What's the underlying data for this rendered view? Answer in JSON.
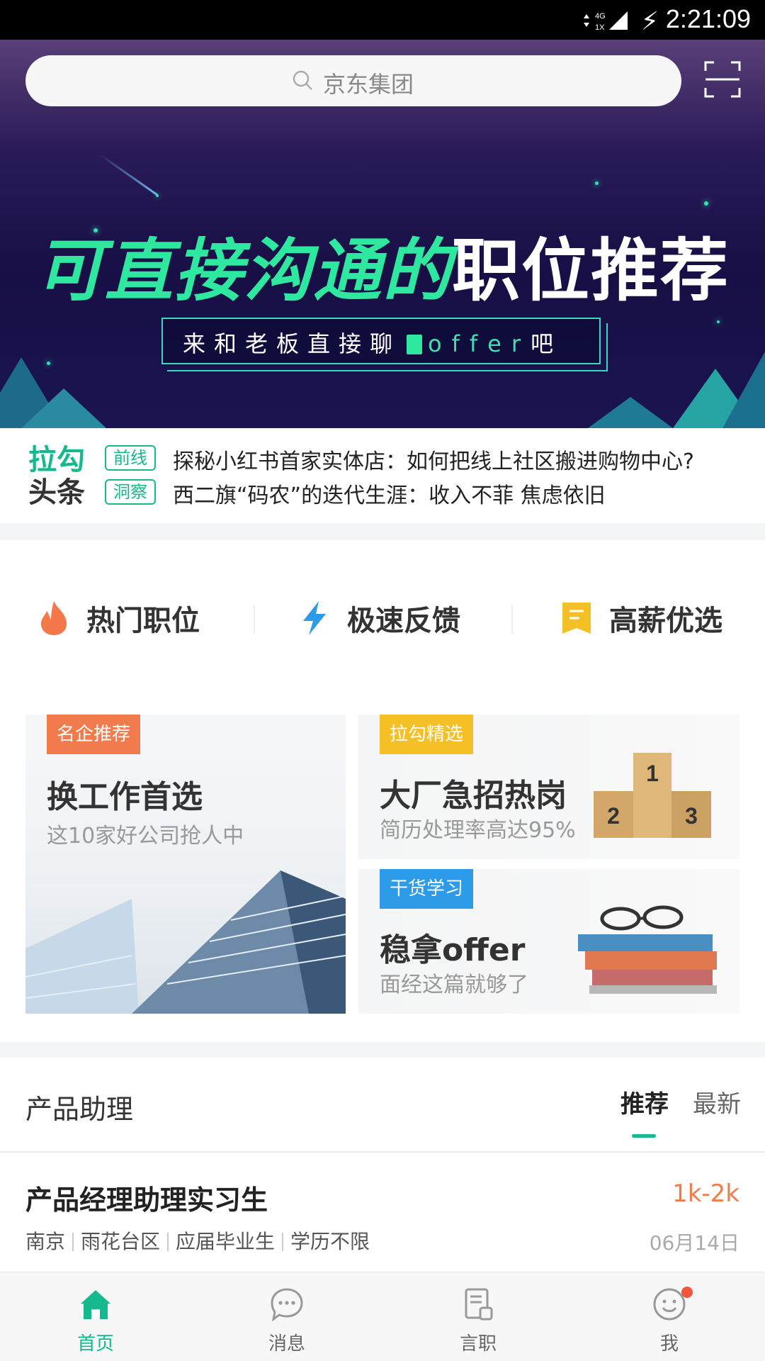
{
  "status_bar": {
    "time": "2:21:09",
    "network": "4G",
    "sim": "1X"
  },
  "banner": {
    "search_placeholder": "京东集团",
    "headline_green": "可直接沟通的",
    "headline_white": "职位推荐",
    "sub_pre": "来和老板直接聊",
    "sub_offer": "offer",
    "sub_post": "吧"
  },
  "news": {
    "logo_top": "拉勾",
    "logo_bottom": "头条",
    "items": [
      {
        "tag": "前线",
        "text": "探秘小红书首家实体店：如何把线上社区搬进购物中心?"
      },
      {
        "tag": "洞察",
        "text": "西二旗“码农”的迭代生涯：收入不菲 焦虑依旧"
      }
    ]
  },
  "quick_entries": [
    {
      "label": "热门职位",
      "icon": "flame-icon"
    },
    {
      "label": "极速反馈",
      "icon": "lightning-icon"
    },
    {
      "label": "高薪优选",
      "icon": "bookmark-icon"
    }
  ],
  "cards": {
    "left": {
      "badge": "名企推荐",
      "title": "换工作首选",
      "desc": "这10家好公司抢人中"
    },
    "right_top": {
      "badge": "拉勾精选",
      "title": "大厂急招热岗",
      "desc": "简历处理率高达95%"
    },
    "right_bottom": {
      "badge": "干货学习",
      "title": "稳拿offer",
      "desc": "面经这篇就够了"
    }
  },
  "section": {
    "title": "产品助理",
    "tab_active": "推荐",
    "tab_other": "最新"
  },
  "job": {
    "title": "产品经理助理实习生",
    "salary": "1k-2k",
    "meta": [
      "南京",
      "雨花台区",
      "应届毕业生",
      "学历不限"
    ],
    "date": "06月14日"
  },
  "nav": [
    {
      "label": "首页",
      "icon": "home-icon",
      "active": true
    },
    {
      "label": "消息",
      "icon": "message-icon",
      "active": false
    },
    {
      "label": "言职",
      "icon": "document-icon",
      "active": false
    },
    {
      "label": "我",
      "icon": "profile-icon",
      "active": false,
      "has_notification": true
    }
  ],
  "colors": {
    "accent": "#14b98d",
    "salary": "#f27b4e",
    "badge_orange": "#f27b4e",
    "badge_yellow": "#f5c026",
    "badge_blue": "#2d9be8"
  }
}
